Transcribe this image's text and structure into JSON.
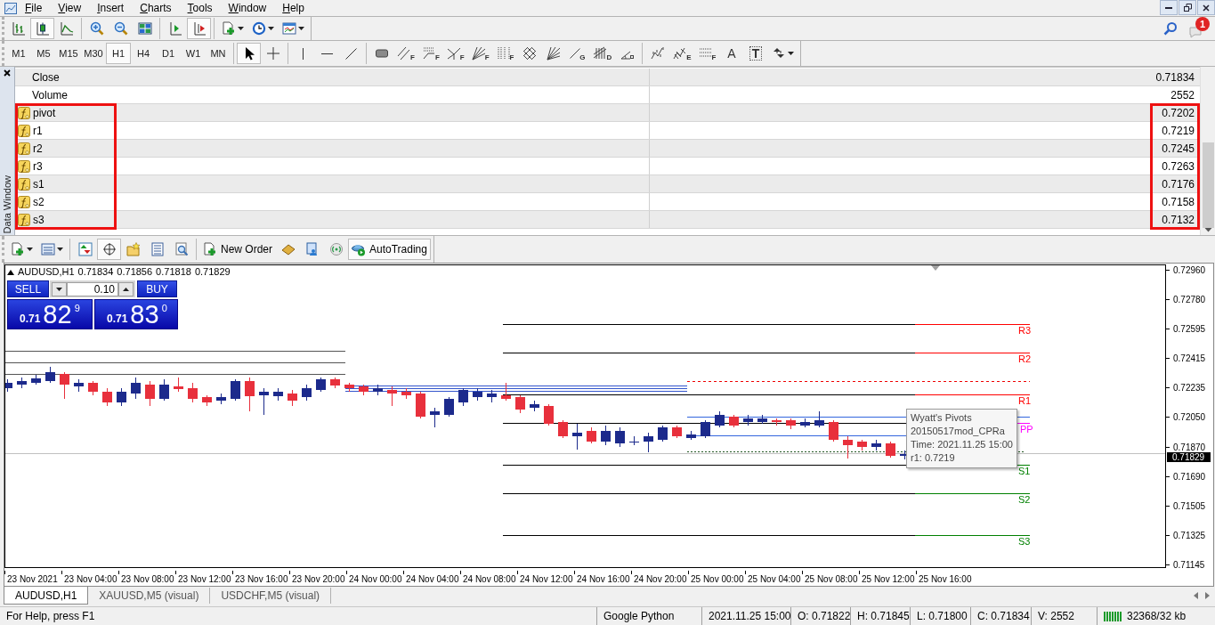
{
  "menu_bar": [
    "File",
    "View",
    "Insert",
    "Charts",
    "Tools",
    "Window",
    "Help"
  ],
  "notifications": {
    "count": "1"
  },
  "main_toolbar": {
    "groups": [
      [
        {
          "kind": "bars",
          "pressed": false
        },
        {
          "kind": "candles",
          "pressed": true
        },
        {
          "kind": "line",
          "pressed": false
        }
      ],
      [
        {
          "kind": "zoom-in",
          "pressed": false
        },
        {
          "kind": "zoom-out",
          "pressed": false
        },
        {
          "kind": "tile",
          "pressed": false
        }
      ],
      [
        {
          "kind": "shift",
          "pressed": false
        },
        {
          "kind": "autoscroll",
          "pressed": true
        }
      ],
      [
        {
          "kind": "new-chart",
          "pressed": false
        },
        {
          "kind": "periods",
          "pressed": false
        },
        {
          "kind": "templates",
          "pressed": false
        }
      ]
    ]
  },
  "timeframes": [
    {
      "label": "M1",
      "selected": false
    },
    {
      "label": "M5",
      "selected": false
    },
    {
      "label": "M15",
      "selected": false
    },
    {
      "label": "M30",
      "selected": false
    },
    {
      "label": "H1",
      "selected": true
    },
    {
      "label": "H4",
      "selected": false
    },
    {
      "label": "D1",
      "selected": false
    },
    {
      "label": "W1",
      "selected": false
    },
    {
      "label": "MN",
      "selected": false
    }
  ],
  "drawing_toolbar": {
    "groups": [
      [
        {
          "kind": "cursor",
          "pressed": true
        },
        {
          "kind": "crosshair",
          "pressed": false
        }
      ],
      [
        {
          "kind": "vline",
          "pressed": false
        },
        {
          "kind": "hline",
          "pressed": false
        },
        {
          "kind": "trendline",
          "pressed": false
        }
      ],
      [
        {
          "kind": "rectangle",
          "pressed": false
        },
        {
          "kind": "channel",
          "tag": "F",
          "pressed": false
        },
        {
          "kind": "retracement",
          "tag": "F",
          "pressed": false
        },
        {
          "kind": "pitchfork",
          "tag": "F",
          "pressed": false
        },
        {
          "kind": "fan",
          "tag": "F",
          "pressed": false
        },
        {
          "kind": "timezones",
          "tag": "F",
          "pressed": false
        },
        {
          "kind": "grid",
          "pressed": false
        },
        {
          "kind": "gannfan",
          "pressed": false
        },
        {
          "kind": "gannline",
          "tag": "G",
          "pressed": false
        },
        {
          "kind": "cycles",
          "tag": "D",
          "pressed": false
        },
        {
          "kind": "angle",
          "pressed": false
        }
      ],
      [
        {
          "kind": "waves",
          "pressed": false
        },
        {
          "kind": "waves2",
          "tag": "E",
          "pressed": false
        },
        {
          "kind": "expansion",
          "tag": "F",
          "pressed": false
        },
        {
          "kind": "text",
          "glyph": "A",
          "pressed": false
        },
        {
          "kind": "label",
          "glyph": "T",
          "pressed": false
        },
        {
          "kind": "arrows",
          "pressed": false
        }
      ]
    ]
  },
  "data_window": {
    "title": "Data Window",
    "sections": [
      {
        "highlighted": false,
        "rows": [
          {
            "kind": "plain",
            "name": "Close",
            "value": "0.71834"
          },
          {
            "kind": "plain",
            "name": "Volume",
            "value": "2552"
          }
        ]
      },
      {
        "highlighted": true,
        "rows": [
          {
            "kind": "indicator",
            "name": "pivot",
            "value": "0.7202"
          },
          {
            "kind": "indicator",
            "name": "r1",
            "value": "0.7219"
          },
          {
            "kind": "indicator",
            "name": "r2",
            "value": "0.7245"
          },
          {
            "kind": "indicator",
            "name": "r3",
            "value": "0.7263"
          },
          {
            "kind": "indicator",
            "name": "s1",
            "value": "0.7176"
          },
          {
            "kind": "indicator",
            "name": "s2",
            "value": "0.7158"
          },
          {
            "kind": "indicator",
            "name": "s3",
            "value": "0.7132"
          }
        ]
      }
    ]
  },
  "terminal_toolbar": {
    "groups": [
      [
        {
          "kind": "new-chart",
          "pressed": false
        },
        {
          "kind": "profiles",
          "pressed": false
        }
      ],
      [
        {
          "kind": "market-watch",
          "pressed": false
        },
        {
          "kind": "data-window",
          "pressed": true
        },
        {
          "kind": "navigator",
          "pressed": false
        },
        {
          "kind": "terminal",
          "pressed": false
        },
        {
          "kind": "tester",
          "pressed": false
        }
      ],
      [
        {
          "kind": "new-order",
          "label": "New Order",
          "pressed": false
        },
        {
          "kind": "metaeditor",
          "pressed": false
        },
        {
          "kind": "signals",
          "pressed": false
        },
        {
          "kind": "market",
          "pressed": false
        },
        {
          "kind": "autotrading",
          "label": "AutoTrading",
          "pressed": true
        }
      ]
    ]
  },
  "chart": {
    "header": {
      "symbol": "AUDUSD,H1",
      "prices": [
        "0.71834",
        "0.71856",
        "0.71818",
        "0.71829"
      ]
    },
    "one_click": {
      "sell": "SELL",
      "buy": "BUY",
      "lot": "0.10",
      "bid": {
        "prefix": "0.71",
        "big": "82",
        "small": "9"
      },
      "ask": {
        "prefix": "0.71",
        "big": "83",
        "small": "0"
      }
    },
    "levels": [
      {
        "label": "R3",
        "color": "#ff0000"
      },
      {
        "label": "R2",
        "color": "#ff0000"
      },
      {
        "label": "R1",
        "color": "#ff0000"
      },
      {
        "label": "PP",
        "color": "#ff00ff"
      },
      {
        "label": "S1",
        "color": "#008000"
      },
      {
        "label": "S2",
        "color": "#008000"
      },
      {
        "label": "S3",
        "color": "#008000"
      }
    ],
    "tooltip": [
      "Wyatt's Pivots",
      "20150517mod_CPRa",
      "Time: 2021.11.25 15:00",
      "r1: 0.7219"
    ],
    "price_labels": [
      "0.72960",
      "0.72780",
      "0.72595",
      "0.72415",
      "0.72235",
      "0.72050",
      "0.71870",
      "0.71690",
      "0.71505",
      "0.71325",
      "0.71145"
    ],
    "current_price": "0.71829",
    "time_labels": [
      "23 Nov 2021",
      "23 Nov 04:00",
      "23 Nov 08:00",
      "23 Nov 12:00",
      "23 Nov 16:00",
      "23 Nov 20:00",
      "24 Nov 00:00",
      "24 Nov 04:00",
      "24 Nov 08:00",
      "24 Nov 12:00",
      "24 Nov 16:00",
      "24 Nov 20:00",
      "25 Nov 00:00",
      "25 Nov 04:00",
      "25 Nov 08:00",
      "25 Nov 12:00",
      "25 Nov 16:00"
    ]
  },
  "chart_tabs": [
    {
      "label": "AUDUSD,H1",
      "selected": true
    },
    {
      "label": "XAUUSD,M5 (visual)",
      "selected": false
    },
    {
      "label": "USDCHF,M5 (visual)",
      "selected": false
    }
  ],
  "status_bar": {
    "help": "For Help, press F1",
    "profile": "Google Python",
    "time": "2021.11.25 15:00",
    "open": "O: 0.71822",
    "high": "H: 0.71845",
    "low": "L: 0.71800",
    "close": "C: 0.71834",
    "volume": "V: 2552",
    "traffic": "32368/32 kb"
  }
}
